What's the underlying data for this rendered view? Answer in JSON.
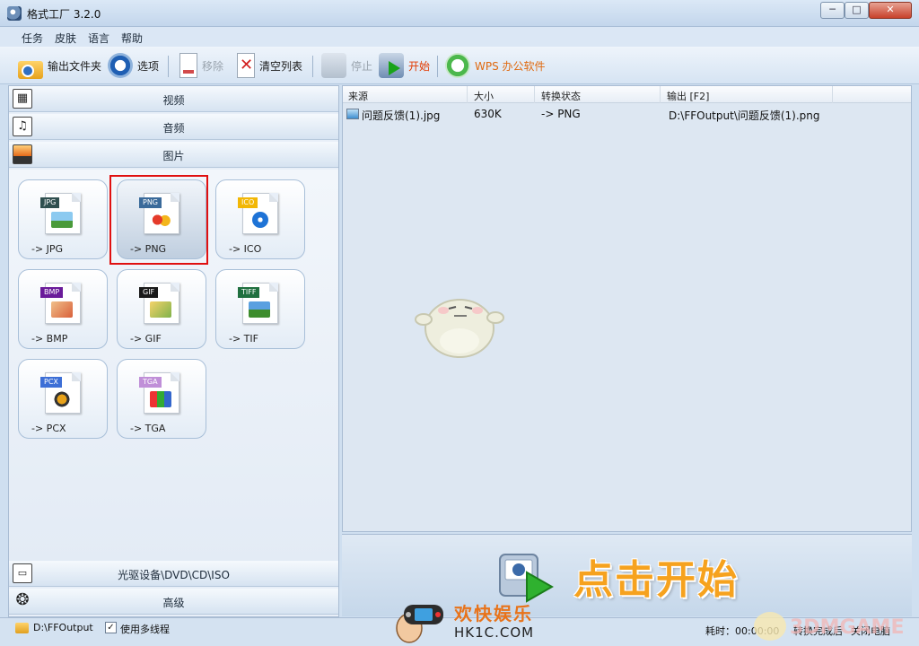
{
  "window": {
    "title": "格式工厂 3.2.0",
    "min_symbol": "─",
    "max_symbol": "□",
    "close_symbol": "✕"
  },
  "menu": [
    "任务",
    "皮肤",
    "语言",
    "帮助"
  ],
  "toolbar": {
    "output_folder": "输出文件夹",
    "options": "选项",
    "remove": "移除",
    "clear_list": "清空列表",
    "stop": "停止",
    "start": "开始",
    "wps": "WPS 办公软件"
  },
  "categories": {
    "video": "视频",
    "audio": "音频",
    "image": "图片",
    "rom": "光驱设备\\DVD\\CD\\ISO",
    "advanced": "高级"
  },
  "image_formats": [
    {
      "tag": "JPG",
      "label": "-> JPG",
      "tag_color": "#2f4f4f"
    },
    {
      "tag": "PNG",
      "label": "-> PNG",
      "tag_color": "#3a6a9a"
    },
    {
      "tag": "ICO",
      "label": "-> ICO",
      "tag_color": "#f2b705"
    },
    {
      "tag": "BMP",
      "label": "-> BMP",
      "tag_color": "#6a1b9a"
    },
    {
      "tag": "GIF",
      "label": "-> GIF",
      "tag_color": "#1a1a1a"
    },
    {
      "tag": "TIFF",
      "label": "-> TIF",
      "tag_color": "#1f6f3f"
    },
    {
      "tag": "PCX",
      "label": "-> PCX",
      "tag_color": "#3d6fd6"
    },
    {
      "tag": "TGA",
      "label": "-> TGA",
      "tag_color": "#c08fd8"
    }
  ],
  "selected_format": "PNG",
  "table": {
    "headers": [
      "来源",
      "大小",
      "转换状态",
      "输出 [F2]"
    ],
    "rows": [
      {
        "source": "问题反馈(1).jpg",
        "size": "630K",
        "status": "-> PNG",
        "output": "D:\\FFOutput\\问题反馈(1).png"
      }
    ]
  },
  "banner": {
    "text": "点击开始"
  },
  "status": {
    "output_path": "D:\\FFOutput",
    "multithread_checked": true,
    "multithread_label": "使用多线程",
    "elapsed": "耗时：00:00:00",
    "after": "转换完成后",
    "shutdown": "关闭电脑"
  },
  "watermark": {
    "site_title": "欢快娱乐",
    "site_url": "HK1C.COM",
    "brand": "3DMGAME"
  }
}
